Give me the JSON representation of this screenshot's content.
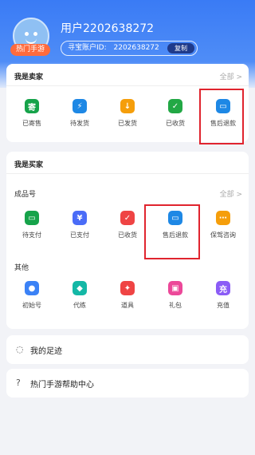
{
  "profile": {
    "username": "用户2202638272",
    "avatar_badge": "热门手游",
    "id_label": "寻宝账户ID:",
    "id_value": "2202638272",
    "copy_label": "复制"
  },
  "seller": {
    "title": "我是卖家",
    "more": "全部 >",
    "items": [
      {
        "label": "已寄售",
        "icon": "consign-icon",
        "glyph": "寄",
        "color": "#16a34a"
      },
      {
        "label": "待发货",
        "icon": "lightning-icon",
        "glyph": "⚡",
        "color": "#1e88e5"
      },
      {
        "label": "已发货",
        "icon": "box-icon",
        "glyph": "↓",
        "color": "#f59e0b"
      },
      {
        "label": "已收货",
        "icon": "check-icon",
        "glyph": "✓",
        "color": "#22a845"
      },
      {
        "label": "售后退款",
        "icon": "wallet-refund-icon",
        "glyph": "▭",
        "color": "#1e88e5"
      }
    ]
  },
  "buyer": {
    "title": "我是买家",
    "finished": {
      "title": "成品号",
      "more": "全部 >",
      "items": [
        {
          "label": "待支付",
          "icon": "wallet-icon",
          "glyph": "▭",
          "color": "#16a34a"
        },
        {
          "label": "已支付",
          "icon": "yuan-icon",
          "glyph": "¥",
          "color": "#4a6cf7"
        },
        {
          "label": "已收货",
          "icon": "received-icon",
          "glyph": "✓",
          "color": "#ef4444"
        },
        {
          "label": "售后退款",
          "icon": "wallet-refund-icon",
          "glyph": "▭",
          "color": "#1e88e5"
        },
        {
          "label": "保驾咨询",
          "icon": "consult-icon",
          "glyph": "⋯",
          "color": "#f59e0b"
        }
      ]
    },
    "other": {
      "title": "其他",
      "items": [
        {
          "label": "初始号",
          "icon": "person-icon",
          "glyph": "●",
          "color": "#3b82f6"
        },
        {
          "label": "代练",
          "icon": "boost-icon",
          "glyph": "◆",
          "color": "#14b8a6"
        },
        {
          "label": "道具",
          "icon": "item-icon",
          "glyph": "✦",
          "color": "#ef4444"
        },
        {
          "label": "礼包",
          "icon": "gift-icon",
          "glyph": "▣",
          "color": "#ec4899"
        },
        {
          "label": "充值",
          "icon": "recharge-icon",
          "glyph": "充",
          "color": "#8b5cf6"
        }
      ]
    }
  },
  "links": [
    {
      "label": "我的足迹",
      "icon": "footprint-icon",
      "glyph": "◌"
    },
    {
      "label": "热门手游帮助中心",
      "icon": "help-icon",
      "glyph": "?"
    }
  ]
}
